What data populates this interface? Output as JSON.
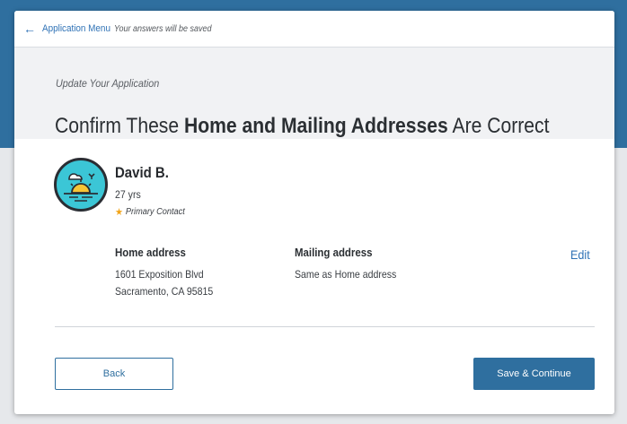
{
  "topbar": {
    "back_icon": "arrow-left-icon",
    "menu_link": "Application Menu",
    "save_note": "Your answers will be saved"
  },
  "header": {
    "eyebrow": "Update Your Application",
    "title_pre": "Confirm These ",
    "title_bold": "Home and Mailing Addresses",
    "title_post": " Are Correct"
  },
  "person": {
    "avatar_icon": "sunrise-avatar-icon",
    "name": "David B.",
    "age": "27 yrs",
    "role_icon": "star-icon",
    "role": "Primary Contact"
  },
  "addresses": {
    "home_label": "Home address",
    "home_line1": "1601 Exposition Blvd",
    "home_line2": "Sacramento, CA 95815",
    "mailing_label": "Mailing address",
    "mailing_value": "Same as Home address",
    "edit_label": "Edit"
  },
  "actions": {
    "back_label": "Back",
    "save_label": "Save & Continue"
  },
  "colors": {
    "brand_blue": "#2f6f9f",
    "link_blue": "#2f72b6",
    "avatar_teal": "#3bc6d6",
    "star_gold": "#f2a51a"
  }
}
